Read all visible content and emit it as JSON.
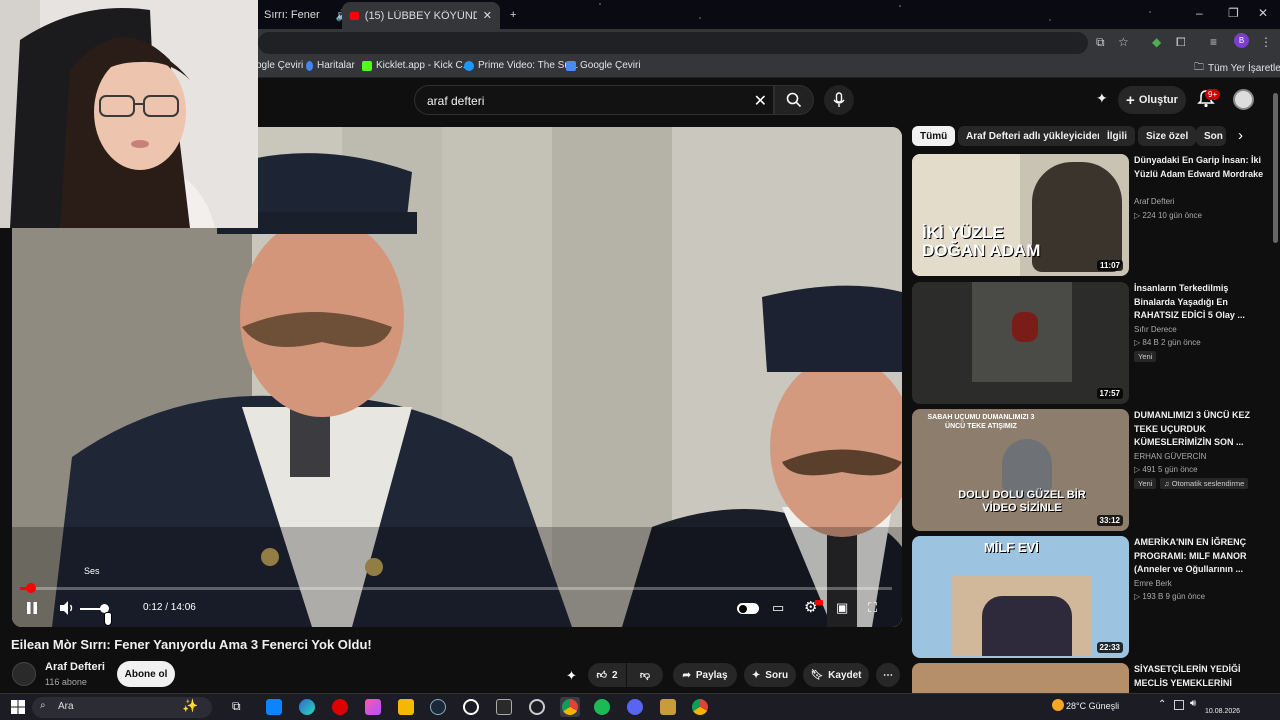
{
  "browser": {
    "tabs": [
      {
        "label": "Sırrı: Fener"
      },
      {
        "label": "(15) LÜBBEY KÖYÜNDE BİR GE"
      }
    ],
    "new_tab": "+",
    "bookmarks": [
      {
        "label": "ogle Çeviri"
      },
      {
        "label": "Haritalar"
      },
      {
        "label": "Kicklet.app - Kick C..."
      },
      {
        "label": "Prime Video: The Su..."
      },
      {
        "label": "Google Çeviri"
      }
    ],
    "all_bookmarks": "Tüm Yer İşaretleri",
    "profile_letter": "B"
  },
  "header": {
    "search_query": "araf defteri",
    "create_label": "Oluştur",
    "notif_count": "9+"
  },
  "player": {
    "time": "0:12 / 14:06",
    "progress_fraction": 0.014,
    "volume_tooltip": "Ses"
  },
  "video": {
    "title": "Eilean Mòr Sırrı: Fener Yanıyordu Ama 3 Fenerci Yok Oldu!",
    "channel": "Araf Defteri",
    "subscribers": "116 abone",
    "subscribe_label": "Abone ol",
    "likes": "2",
    "share_label": "Paylaş",
    "ask_label": "Soru",
    "save_label": "Kaydet"
  },
  "chips": [
    "Tümü",
    "Araf Defteri adlı yükleyiciden",
    "İlgili",
    "Size özel",
    "Son"
  ],
  "recommendations": [
    {
      "title": "Dünyadaki En Garip İnsan: İki Yüzlü Adam Edward Mordrake",
      "channel": "Araf Defteri",
      "meta": "224  10 gün önce",
      "duration": "11:07",
      "thumb_text": "İKİ YÜZLE DOĞAN ADAM",
      "badges": []
    },
    {
      "title": "İnsanların Terkedilmiş Binalarda Yaşadığı En RAHATSIZ EDİCİ 5 Olay ...",
      "channel": "Sıfır Derece",
      "meta": "84 B  2 gün önce",
      "duration": "17:57",
      "thumb_text": "",
      "badges": [
        "Yeni"
      ]
    },
    {
      "title": "DUMANLIMIZI 3 ÜNCÜ KEZ TEKE UÇURDUK KÜMESLERİMİZİN SON ...",
      "channel": "ERHAN GÜVERCİN",
      "meta": "491  5 gün önce",
      "duration": "33:12",
      "thumb_text": "DOLU DOLU GÜZEL BİR VİDEO SİZİNLE",
      "thumb_top_text": "SABAH UÇUMU DUMANLIMIZI 3 ÜNCÜ TEKE ATIŞIMIZ",
      "badges": [
        "Yeni",
        "Otomatik seslendirme"
      ]
    },
    {
      "title": "AMERİKA'NIN EN İĞRENÇ PROGRAMI: MILF MANOR (Anneler ve Oğullarının ...",
      "channel": "Emre Berk",
      "meta": "193 B  9 gün önce",
      "duration": "22:33",
      "thumb_text": "MİLF EVİ",
      "badges": []
    },
    {
      "title": "SİYASETÇİLERİN YEDİĞİ MECLİS YEMEKLERİNİ",
      "channel": "",
      "meta": "",
      "duration": "",
      "thumb_text": "",
      "badges": []
    }
  ],
  "taskbar": {
    "search_placeholder": "Ara",
    "weather": "28°C  Güneşli",
    "date": "10.08.2026"
  },
  "colors": {
    "accent_red": "#ff0000",
    "background": "#0f0f0f",
    "chip_bg": "#272727"
  }
}
